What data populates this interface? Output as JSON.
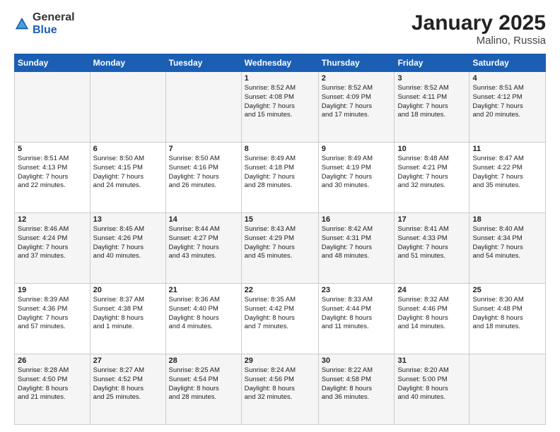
{
  "logo": {
    "general": "General",
    "blue": "Blue"
  },
  "header": {
    "month": "January 2025",
    "location": "Malino, Russia"
  },
  "weekdays": [
    "Sunday",
    "Monday",
    "Tuesday",
    "Wednesday",
    "Thursday",
    "Friday",
    "Saturday"
  ],
  "weeks": [
    [
      {
        "day": "",
        "info": ""
      },
      {
        "day": "",
        "info": ""
      },
      {
        "day": "",
        "info": ""
      },
      {
        "day": "1",
        "info": "Sunrise: 8:52 AM\nSunset: 4:08 PM\nDaylight: 7 hours\nand 15 minutes."
      },
      {
        "day": "2",
        "info": "Sunrise: 8:52 AM\nSunset: 4:09 PM\nDaylight: 7 hours\nand 17 minutes."
      },
      {
        "day": "3",
        "info": "Sunrise: 8:52 AM\nSunset: 4:11 PM\nDaylight: 7 hours\nand 18 minutes."
      },
      {
        "day": "4",
        "info": "Sunrise: 8:51 AM\nSunset: 4:12 PM\nDaylight: 7 hours\nand 20 minutes."
      }
    ],
    [
      {
        "day": "5",
        "info": "Sunrise: 8:51 AM\nSunset: 4:13 PM\nDaylight: 7 hours\nand 22 minutes."
      },
      {
        "day": "6",
        "info": "Sunrise: 8:50 AM\nSunset: 4:15 PM\nDaylight: 7 hours\nand 24 minutes."
      },
      {
        "day": "7",
        "info": "Sunrise: 8:50 AM\nSunset: 4:16 PM\nDaylight: 7 hours\nand 26 minutes."
      },
      {
        "day": "8",
        "info": "Sunrise: 8:49 AM\nSunset: 4:18 PM\nDaylight: 7 hours\nand 28 minutes."
      },
      {
        "day": "9",
        "info": "Sunrise: 8:49 AM\nSunset: 4:19 PM\nDaylight: 7 hours\nand 30 minutes."
      },
      {
        "day": "10",
        "info": "Sunrise: 8:48 AM\nSunset: 4:21 PM\nDaylight: 7 hours\nand 32 minutes."
      },
      {
        "day": "11",
        "info": "Sunrise: 8:47 AM\nSunset: 4:22 PM\nDaylight: 7 hours\nand 35 minutes."
      }
    ],
    [
      {
        "day": "12",
        "info": "Sunrise: 8:46 AM\nSunset: 4:24 PM\nDaylight: 7 hours\nand 37 minutes."
      },
      {
        "day": "13",
        "info": "Sunrise: 8:45 AM\nSunset: 4:26 PM\nDaylight: 7 hours\nand 40 minutes."
      },
      {
        "day": "14",
        "info": "Sunrise: 8:44 AM\nSunset: 4:27 PM\nDaylight: 7 hours\nand 43 minutes."
      },
      {
        "day": "15",
        "info": "Sunrise: 8:43 AM\nSunset: 4:29 PM\nDaylight: 7 hours\nand 45 minutes."
      },
      {
        "day": "16",
        "info": "Sunrise: 8:42 AM\nSunset: 4:31 PM\nDaylight: 7 hours\nand 48 minutes."
      },
      {
        "day": "17",
        "info": "Sunrise: 8:41 AM\nSunset: 4:33 PM\nDaylight: 7 hours\nand 51 minutes."
      },
      {
        "day": "18",
        "info": "Sunrise: 8:40 AM\nSunset: 4:34 PM\nDaylight: 7 hours\nand 54 minutes."
      }
    ],
    [
      {
        "day": "19",
        "info": "Sunrise: 8:39 AM\nSunset: 4:36 PM\nDaylight: 7 hours\nand 57 minutes."
      },
      {
        "day": "20",
        "info": "Sunrise: 8:37 AM\nSunset: 4:38 PM\nDaylight: 8 hours\nand 1 minute."
      },
      {
        "day": "21",
        "info": "Sunrise: 8:36 AM\nSunset: 4:40 PM\nDaylight: 8 hours\nand 4 minutes."
      },
      {
        "day": "22",
        "info": "Sunrise: 8:35 AM\nSunset: 4:42 PM\nDaylight: 8 hours\nand 7 minutes."
      },
      {
        "day": "23",
        "info": "Sunrise: 8:33 AM\nSunset: 4:44 PM\nDaylight: 8 hours\nand 11 minutes."
      },
      {
        "day": "24",
        "info": "Sunrise: 8:32 AM\nSunset: 4:46 PM\nDaylight: 8 hours\nand 14 minutes."
      },
      {
        "day": "25",
        "info": "Sunrise: 8:30 AM\nSunset: 4:48 PM\nDaylight: 8 hours\nand 18 minutes."
      }
    ],
    [
      {
        "day": "26",
        "info": "Sunrise: 8:28 AM\nSunset: 4:50 PM\nDaylight: 8 hours\nand 21 minutes."
      },
      {
        "day": "27",
        "info": "Sunrise: 8:27 AM\nSunset: 4:52 PM\nDaylight: 8 hours\nand 25 minutes."
      },
      {
        "day": "28",
        "info": "Sunrise: 8:25 AM\nSunset: 4:54 PM\nDaylight: 8 hours\nand 28 minutes."
      },
      {
        "day": "29",
        "info": "Sunrise: 8:24 AM\nSunset: 4:56 PM\nDaylight: 8 hours\nand 32 minutes."
      },
      {
        "day": "30",
        "info": "Sunrise: 8:22 AM\nSunset: 4:58 PM\nDaylight: 8 hours\nand 36 minutes."
      },
      {
        "day": "31",
        "info": "Sunrise: 8:20 AM\nSunset: 5:00 PM\nDaylight: 8 hours\nand 40 minutes."
      },
      {
        "day": "",
        "info": ""
      }
    ]
  ]
}
